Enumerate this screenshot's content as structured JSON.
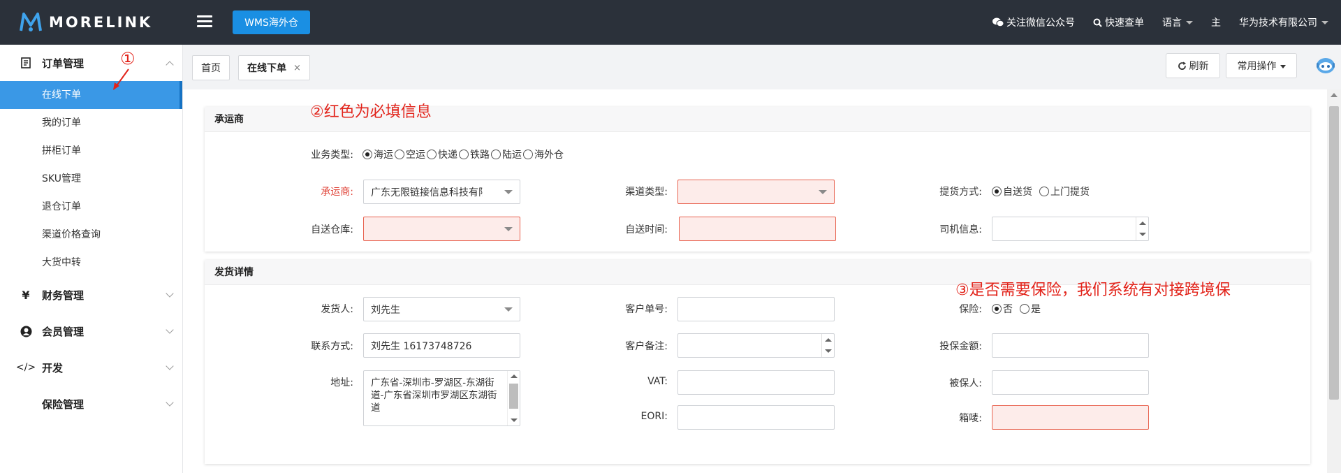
{
  "header": {
    "logo_text": "MORELINK",
    "wms_button": "WMS海外仓",
    "wechat": "关注微信公众号",
    "quick_order": "快速查单",
    "language": "语言",
    "theme": "主",
    "company": "华为技术有限公司"
  },
  "sidebar": {
    "groups": [
      {
        "label": "订单管理",
        "icon": "order-list-icon",
        "expanded": true
      },
      {
        "label": "财务管理",
        "icon": "yen-icon"
      },
      {
        "label": "会员管理",
        "icon": "user-icon"
      },
      {
        "label": "开发",
        "icon": "code-icon"
      },
      {
        "label": "保险管理",
        "icon": ""
      }
    ],
    "order_items": [
      "在线下单",
      "我的订单",
      "拼柜订单",
      "SKU管理",
      "退仓订单",
      "渠道价格查询",
      "大货中转"
    ],
    "active_item": "在线下单"
  },
  "tabs": {
    "home": "首页",
    "current": "在线下单",
    "close": "×",
    "refresh": "刷新",
    "common_ops": "常用操作"
  },
  "carrier_section": {
    "title": "承运商",
    "business_type_label": "业务类型:",
    "business_types": [
      "海运",
      "空运",
      "快递",
      "铁路",
      "陆运",
      "海外仓"
    ],
    "business_type_selected": "海运",
    "carrier_label": "承运商:",
    "carrier_value": "广东无限链接信息科技有限",
    "channel_type_label": "渠道类型:",
    "channel_type_value": "",
    "pickup_method_label": "提货方式:",
    "pickup_methods": [
      "自送货",
      "上门提货"
    ],
    "pickup_method_selected": "自送货",
    "self_warehouse_label": "自送仓库:",
    "self_warehouse_value": "",
    "self_time_label": "自送时间:",
    "self_time_value": "",
    "driver_info_label": "司机信息:",
    "driver_info_value": ""
  },
  "shipping_section": {
    "title": "发货详情",
    "sender_label": "发货人:",
    "sender_value": "刘先生",
    "customer_no_label": "客户单号:",
    "customer_no_value": "",
    "insurance_label": "保险:",
    "insurance_options": [
      "否",
      "是"
    ],
    "insurance_selected": "否",
    "contact_label": "联系方式:",
    "contact_value": "刘先生 16173748726",
    "customer_note_label": "客户备注:",
    "customer_note_value": "",
    "insured_amount_label": "投保金额:",
    "insured_amount_value": "",
    "address_label": "地址:",
    "address_value": "广东省-深圳市-罗湖区-东湖街道-广东省深圳市罗湖区东湖街道",
    "vat_label": "VAT:",
    "vat_value": "",
    "insured_person_label": "被保人:",
    "insured_person_value": "",
    "eori_label": "EORI:",
    "eori_value": "",
    "shipping_mark_label": "箱唛:",
    "shipping_mark_value": ""
  },
  "annotations": {
    "step1": "①",
    "step2": "②红色为必填信息",
    "step3": "③是否需要保险，我们系统有对接跨境保"
  },
  "colors": {
    "header_bg": "#2b313a",
    "accent_blue": "#1a8fe3",
    "active_menu": "#3a98e6",
    "required_red": "#e0453a",
    "annotation_red": "#e2231a"
  }
}
